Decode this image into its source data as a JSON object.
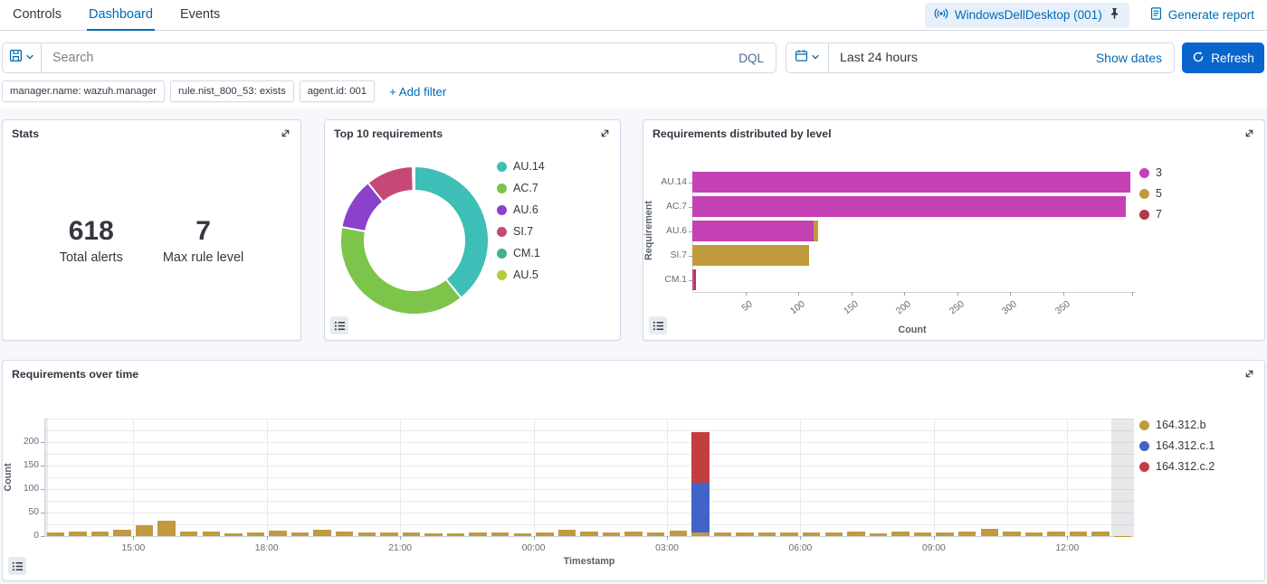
{
  "nav": {
    "tabs": [
      {
        "label": "Controls",
        "active": false
      },
      {
        "label": "Dashboard",
        "active": true
      },
      {
        "label": "Events",
        "active": false
      }
    ],
    "agent_chip_label": "WindowsDellDesktop (001)",
    "generate_report_label": "Generate report"
  },
  "search": {
    "placeholder": "Search",
    "query_language": "DQL",
    "time_range": "Last 24 hours",
    "show_dates_label": "Show dates",
    "refresh_label": "Refresh"
  },
  "filters": {
    "pills": [
      "manager.name: wazuh.manager",
      "rule.nist_800_53: exists",
      "agent.id: 001"
    ],
    "add_filter_label": "+ Add filter"
  },
  "panels": {
    "stats": {
      "title": "Stats",
      "total_alerts": "618",
      "total_alerts_label": "Total alerts",
      "max_rule_level": "7",
      "max_rule_level_label": "Max rule level"
    }
  },
  "chart_data": [
    {
      "type": "pie",
      "donut": true,
      "title": "Top 10 requirements",
      "labels": [
        "AU.14",
        "AC.7",
        "AU.6",
        "SI.7",
        "CM.1",
        "AU.5"
      ],
      "values": [
        413,
        409,
        119,
        110,
        3,
        1
      ],
      "colors": [
        "#3dbeb6",
        "#7cc44a",
        "#8a42cb",
        "#c64878",
        "#3eb482",
        "#b8c83f"
      ],
      "legend_position": "right"
    },
    {
      "type": "bar",
      "orientation": "horizontal",
      "stacked": true,
      "title": "Requirements distributed by level",
      "categories": [
        "AU.14",
        "AC.7",
        "AU.6",
        "SI.7",
        "CM.1"
      ],
      "series": [
        {
          "name": "3",
          "color": "#c441b4",
          "values": [
            413,
            409,
            114,
            0,
            2
          ]
        },
        {
          "name": "5",
          "color": "#c19a3e",
          "values": [
            0,
            0,
            5,
            110,
            0
          ]
        },
        {
          "name": "7",
          "color": "#b03b40",
          "values": [
            0,
            0,
            0,
            0,
            1
          ]
        }
      ],
      "xlabel": "Count",
      "ylabel": "Requirement",
      "x_ticks": [
        50,
        100,
        150,
        200,
        250,
        300,
        350
      ],
      "xlim": [
        0,
        415
      ],
      "legend_position": "right"
    },
    {
      "type": "bar",
      "stacked": true,
      "title": "Requirements over time",
      "xlabel": "Timestamp",
      "ylabel": "Count",
      "y_ticks": [
        0,
        50,
        100,
        150,
        200
      ],
      "ylim": [
        0,
        250
      ],
      "bucket_minutes": 30,
      "x_tick_labels": [
        "15:00",
        "18:00",
        "21:00",
        "00:00",
        "03:00",
        "06:00",
        "09:00",
        "12:00"
      ],
      "x_tick_indices": [
        4,
        10,
        16,
        22,
        28,
        34,
        40,
        46
      ],
      "series": [
        {
          "name": "164.312.b",
          "color": "#c19a3e",
          "values": [
            8,
            10,
            10,
            13,
            24,
            32,
            10,
            9,
            5,
            8,
            12,
            8,
            14,
            10,
            8,
            8,
            7,
            6,
            5,
            7,
            7,
            6,
            8,
            13,
            9,
            8,
            10,
            8,
            12,
            8,
            7,
            8,
            8,
            8,
            8,
            8,
            9,
            6,
            10,
            8,
            7,
            9,
            15,
            10,
            8,
            10,
            9,
            9
          ]
        },
        {
          "name": "164.312.c.1",
          "color": "#4264c8",
          "values": [
            0,
            0,
            0,
            0,
            0,
            0,
            0,
            0,
            0,
            0,
            0,
            0,
            0,
            0,
            0,
            0,
            0,
            0,
            0,
            0,
            0,
            0,
            0,
            0,
            0,
            0,
            0,
            0,
            0,
            105,
            0,
            0,
            0,
            0,
            0,
            0,
            0,
            0,
            0,
            0,
            0,
            0,
            0,
            0,
            0,
            0,
            0,
            0
          ]
        },
        {
          "name": "164.312.c.2",
          "color": "#c33e41",
          "values": [
            0,
            0,
            0,
            0,
            0,
            0,
            0,
            0,
            0,
            0,
            0,
            0,
            0,
            0,
            0,
            0,
            0,
            0,
            0,
            0,
            0,
            0,
            0,
            0,
            0,
            0,
            0,
            0,
            0,
            108,
            0,
            0,
            0,
            0,
            0,
            0,
            0,
            0,
            0,
            0,
            0,
            0,
            0,
            0,
            0,
            0,
            0,
            0
          ]
        }
      ],
      "partial_last_bucket": {
        "value": 1,
        "shaded": true
      },
      "legend_position": "right"
    }
  ]
}
